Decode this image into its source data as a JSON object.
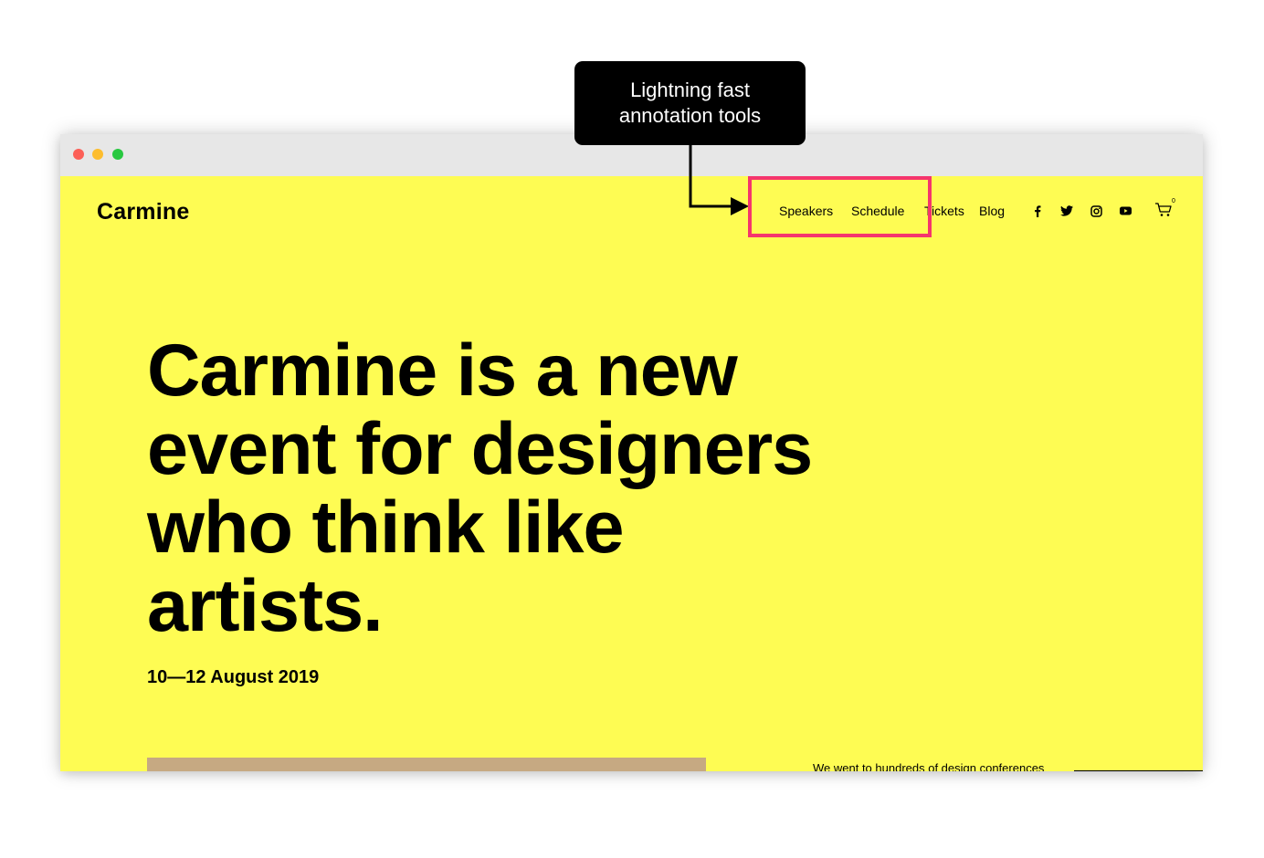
{
  "browser": {
    "window_controls": [
      "close",
      "minimize",
      "zoom"
    ]
  },
  "site": {
    "logo": "Carmine",
    "nav": [
      {
        "label": "Speakers"
      },
      {
        "label": "Schedule"
      },
      {
        "label": "Tickets"
      },
      {
        "label": "Blog"
      }
    ],
    "social_icons": [
      "facebook-icon",
      "twitter-icon",
      "instagram-icon",
      "youtube-icon"
    ],
    "cart": {
      "icon": "cart-icon",
      "count": "0"
    },
    "hero": {
      "headline_lines": [
        "Carmine is a new",
        "event for designers",
        "who think like",
        "artists."
      ],
      "date": "10—12 August 2019",
      "intro_partial": "We went to hundreds of design conferences"
    },
    "colors": {
      "background": "#fefc53",
      "text": "#000000",
      "image_placeholder": "#c6a982"
    }
  },
  "annotation": {
    "callout_lines": [
      "Lightning fast",
      "annotation tools"
    ],
    "highlight_color": "#f5356d"
  }
}
